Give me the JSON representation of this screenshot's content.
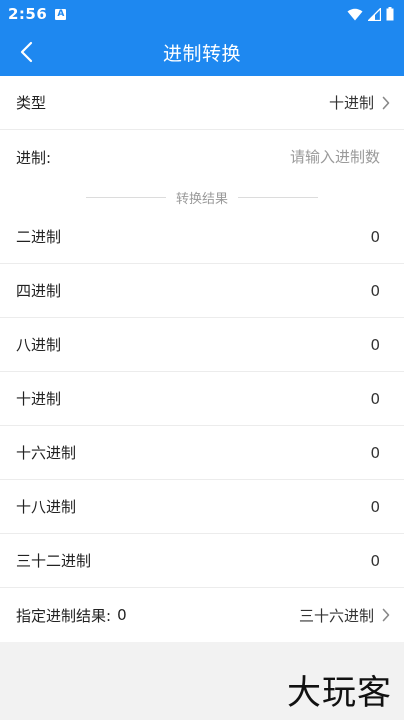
{
  "status_bar": {
    "time": "2:56",
    "notif_letter": "A"
  },
  "header": {
    "title": "进制转换"
  },
  "type_row": {
    "label": "类型",
    "value": "十进制"
  },
  "input_row": {
    "label": "进制:",
    "placeholder": "请输入进制数"
  },
  "divider": {
    "text": "转换结果"
  },
  "results": [
    {
      "label": "二进制",
      "value": "0"
    },
    {
      "label": "四进制",
      "value": "0"
    },
    {
      "label": "八进制",
      "value": "0"
    },
    {
      "label": "十进制",
      "value": "0"
    },
    {
      "label": "十六进制",
      "value": "0"
    },
    {
      "label": "十八进制",
      "value": "0"
    },
    {
      "label": "三十二进制",
      "value": "0"
    }
  ],
  "custom_row": {
    "label": "指定进制结果:",
    "value": "0",
    "selector": "三十六进制"
  },
  "watermark": {
    "text": "大玩客"
  },
  "colors": {
    "primary": "#1e88f0",
    "background": "#f2f2f2"
  }
}
